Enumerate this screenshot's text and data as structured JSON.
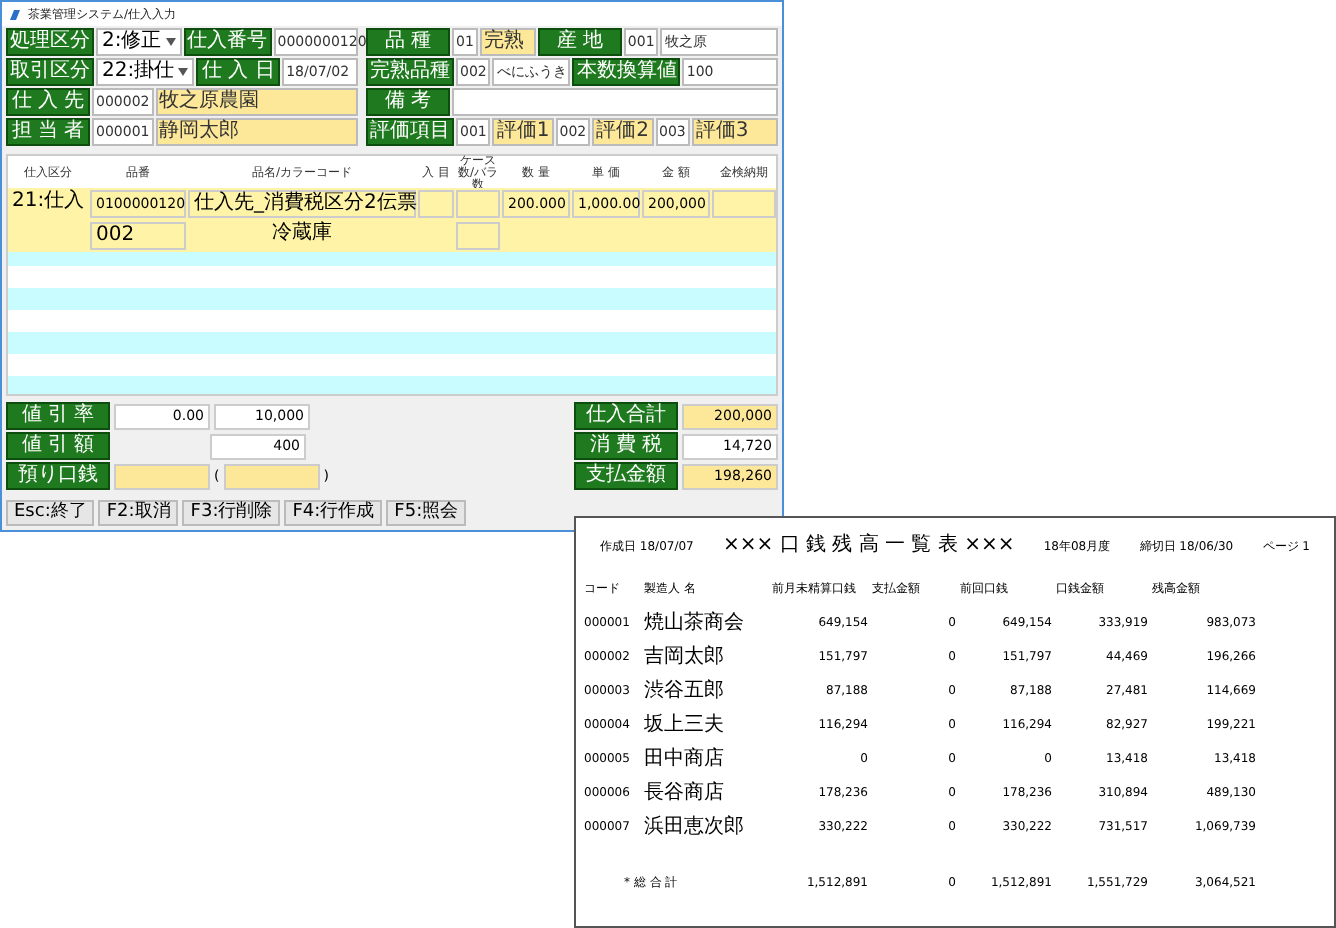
{
  "main_window": {
    "title": "茶業管理システム/仕入入力",
    "form": [
      {
        "left": [
          {
            "kind": "label",
            "text": "処理区分"
          },
          {
            "kind": "select",
            "value": "2:修正"
          },
          {
            "kind": "label",
            "text": "仕入番号"
          },
          {
            "kind": "input",
            "value": "0000000120",
            "highlight": false
          }
        ],
        "right": [
          {
            "kind": "label",
            "text": "品 種"
          },
          {
            "kind": "input",
            "value": "01",
            "highlight": false
          },
          {
            "kind": "input",
            "value": "完熟",
            "highlight": true
          },
          {
            "kind": "label",
            "text": "産 地"
          },
          {
            "kind": "input",
            "value": "001",
            "highlight": false
          },
          {
            "kind": "input",
            "value": "牧之原",
            "highlight": false
          }
        ]
      },
      {
        "left": [
          {
            "kind": "label",
            "text": "取引区分"
          },
          {
            "kind": "select",
            "value": "22:掛仕"
          },
          {
            "kind": "label",
            "text": "仕 入 日"
          },
          {
            "kind": "input",
            "value": "18/07/02",
            "highlight": false
          }
        ],
        "right": [
          {
            "kind": "label",
            "text": "完熟品種"
          },
          {
            "kind": "input",
            "value": "002",
            "highlight": false
          },
          {
            "kind": "input",
            "value": "べにふうき",
            "highlight": false
          },
          {
            "kind": "label",
            "text": "本数換算値"
          },
          {
            "kind": "input",
            "value": "100",
            "highlight": false
          }
        ]
      },
      {
        "left": [
          {
            "kind": "label",
            "text": "仕 入 先"
          },
          {
            "kind": "input",
            "value": "000002",
            "highlight": false
          },
          {
            "kind": "input",
            "value": "牧之原農園",
            "highlight": true
          }
        ],
        "right": [
          {
            "kind": "label",
            "text": "備 考"
          },
          {
            "kind": "input",
            "highlight": false
          }
        ]
      },
      {
        "left": [
          {
            "kind": "label",
            "text": "担 当 者"
          },
          {
            "kind": "input",
            "value": "000001",
            "highlight": false
          },
          {
            "kind": "input",
            "value": "静岡太郎",
            "highlight": true
          }
        ],
        "right": [
          {
            "kind": "label",
            "text": "評価項目"
          },
          {
            "kind": "input",
            "value": "001",
            "highlight": false
          },
          {
            "kind": "input",
            "value": "評価1",
            "highlight": true
          },
          {
            "kind": "input",
            "value": "002",
            "highlight": false
          },
          {
            "kind": "input",
            "value": "評価2",
            "highlight": true
          },
          {
            "kind": "input",
            "value": "003",
            "highlight": false
          },
          {
            "kind": "input",
            "value": "評価3",
            "highlight": true
          }
        ]
      }
    ],
    "grid": {
      "columns": [
        "仕入区分",
        "品番",
        "品名/カラーコード",
        "入 目",
        "ケース数/バラ数",
        "数 量",
        "単 価",
        "金 額",
        "金検納期"
      ],
      "rows": [
        {
          "cells": [
            "21:仕入",
            "0100000120",
            "仕入先_消費税区分2伝票",
            "",
            "",
            "200.000",
            "1,000.00",
            "200,000",
            ""
          ],
          "sub_code": "002",
          "sub_name": "冷蔵庫"
        }
      ]
    },
    "totals_left": [
      {
        "label": "値 引 率",
        "values": [
          "0.00",
          "10,000"
        ]
      },
      {
        "label": "値 引 額",
        "values": [
          "400"
        ]
      },
      {
        "label": "預り口銭",
        "parens": [
          "(",
          ")"
        ]
      }
    ],
    "totals_right": [
      {
        "label": "仕入合計",
        "value": "200,000",
        "highlight": true
      },
      {
        "label": "消 費 税",
        "value": "14,720",
        "highlight": false
      },
      {
        "label": "支払金額",
        "value": "198,260",
        "highlight": true
      }
    ],
    "function_keys": [
      "Esc:終了",
      "F2:取消",
      "F3:行削除",
      "F4:行作成",
      "F5:照会"
    ]
  },
  "report": {
    "created": "作成日 18/07/07",
    "title": "××× 口 銭 残 高 一 覧 表 ×××",
    "period": "18年08月度",
    "closing": "締切日 18/06/30",
    "page": "ページ 1",
    "columns": [
      "コード",
      "製造人 名",
      "前月未精算口銭",
      "支払金額",
      "前回口銭",
      "口銭金額",
      "残高金額"
    ],
    "rows": [
      [
        "000001",
        "焼山茶商会",
        "649,154",
        "0",
        "649,154",
        "333,919",
        "983,073"
      ],
      [
        "000002",
        "吉岡太郎",
        "151,797",
        "0",
        "151,797",
        "44,469",
        "196,266"
      ],
      [
        "000003",
        "渋谷五郎",
        "87,188",
        "0",
        "87,188",
        "27,481",
        "114,669"
      ],
      [
        "000004",
        "坂上三夫",
        "116,294",
        "0",
        "116,294",
        "82,927",
        "199,221"
      ],
      [
        "000005",
        "田中商店",
        "0",
        "0",
        "0",
        "13,418",
        "13,418"
      ],
      [
        "000006",
        "長谷商店",
        "178,236",
        "0",
        "178,236",
        "310,894",
        "489,130"
      ],
      [
        "000007",
        "浜田恵次郎",
        "330,222",
        "0",
        "330,222",
        "731,517",
        "1,069,739"
      ]
    ],
    "total": [
      "* 総 合 計",
      "1,512,891",
      "0",
      "1,512,891",
      "1,551,729",
      "3,064,521"
    ]
  }
}
